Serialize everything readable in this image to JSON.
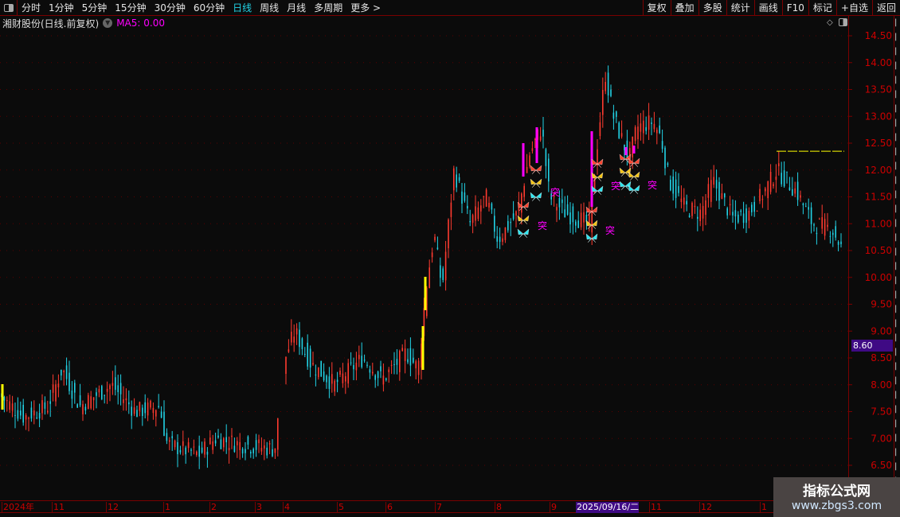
{
  "toolbar": {
    "periods": [
      "分时",
      "1分钟",
      "5分钟",
      "15分钟",
      "30分钟",
      "60分钟",
      "日线",
      "周线",
      "月线",
      "多周期",
      "更多 >"
    ],
    "active": "日线",
    "right_buttons": [
      "复权",
      "叠加",
      "多股",
      "统计",
      "画线",
      "F10",
      "标记",
      "+自选",
      "返回"
    ]
  },
  "title": {
    "stock": "湘财股份(日线.前复权)",
    "ma": "MA5: 0.00"
  },
  "price_axis": {
    "ticks": [
      "14.50",
      "14.00",
      "13.50",
      "13.00",
      "12.50",
      "12.00",
      "11.50",
      "11.00",
      "10.50",
      "10.00",
      "9.50",
      "9.00",
      "8.50",
      "8.00",
      "7.50",
      "7.00",
      "6.50"
    ],
    "current_price_tag": "8.60"
  },
  "time_axis": {
    "labels": [
      "2024年",
      "11",
      "12",
      "1",
      "2",
      "3",
      "4",
      "5",
      "6",
      "7",
      "8",
      "9",
      "2025/09/16/二",
      "11",
      "12",
      "1"
    ],
    "highlighted": "2025/09/16/二"
  },
  "signals": {
    "label": "突"
  },
  "watermark": {
    "title": "指标公式网",
    "url": "www.zbgs3.com"
  },
  "colors": {
    "up": "#ff3b30",
    "down": "#22d3e6",
    "signal": "#ff00ff",
    "highlight": "#ffff00",
    "grid": "#7a0000"
  },
  "chart_data": {
    "type": "candlestick",
    "ylim": [
      6.5,
      14.5
    ],
    "close_path": [
      [
        0,
        7.8
      ],
      [
        30,
        7.4
      ],
      [
        60,
        7.6
      ],
      [
        78,
        8.3
      ],
      [
        100,
        7.6
      ],
      [
        140,
        8.0
      ],
      [
        170,
        7.5
      ],
      [
        200,
        7.6
      ],
      [
        210,
        6.9
      ],
      [
        250,
        6.7
      ],
      [
        270,
        7.0
      ],
      [
        300,
        6.9
      ],
      [
        345,
        6.8
      ],
      [
        358,
        8.5
      ],
      [
        370,
        9.0
      ],
      [
        390,
        8.4
      ],
      [
        420,
        8.0
      ],
      [
        455,
        8.5
      ],
      [
        480,
        8.1
      ],
      [
        510,
        8.6
      ],
      [
        525,
        8.3
      ],
      [
        535,
        9.8
      ],
      [
        545,
        10.8
      ],
      [
        555,
        9.8
      ],
      [
        570,
        12.0
      ],
      [
        590,
        11.0
      ],
      [
        610,
        11.5
      ],
      [
        625,
        10.7
      ],
      [
        650,
        11.2
      ],
      [
        665,
        12.3
      ],
      [
        680,
        12.8
      ],
      [
        690,
        11.5
      ],
      [
        710,
        11.2
      ],
      [
        740,
        11.0
      ],
      [
        750,
        12.5
      ],
      [
        760,
        13.8
      ],
      [
        770,
        13.0
      ],
      [
        790,
        12.2
      ],
      [
        800,
        12.8
      ],
      [
        820,
        12.9
      ],
      [
        830,
        12.6
      ],
      [
        840,
        11.8
      ],
      [
        860,
        11.3
      ],
      [
        880,
        11.2
      ],
      [
        895,
        11.8
      ],
      [
        920,
        11.1
      ],
      [
        940,
        11.2
      ],
      [
        960,
        11.6
      ],
      [
        975,
        12.0
      ],
      [
        1000,
        11.6
      ],
      [
        1020,
        11.0
      ],
      [
        1045,
        10.9
      ],
      [
        1058,
        10.5
      ]
    ],
    "resistance_level": 12.35
  }
}
